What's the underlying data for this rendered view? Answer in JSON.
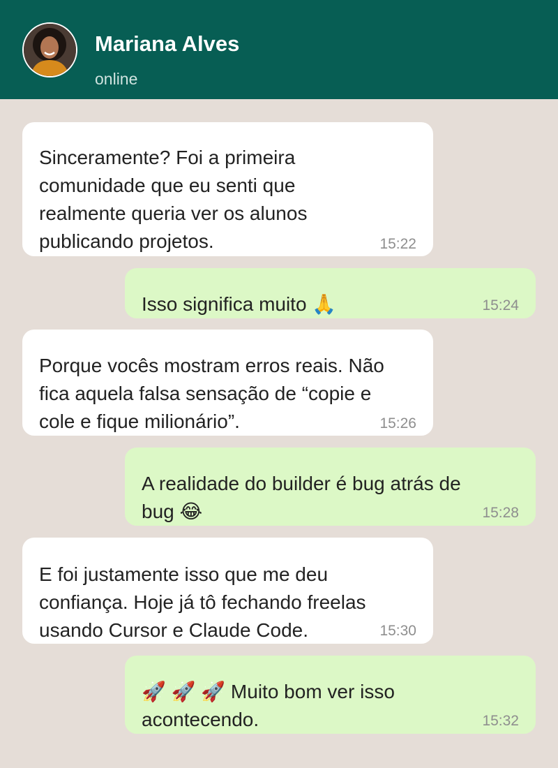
{
  "contact": {
    "name": "Mariana Alves",
    "status": "online"
  },
  "messages": [
    {
      "direction": "in",
      "text": "Sinceramente? Foi a primeira\ncomunidade que eu senti que\nrealmente queria ver os alunos\npublicando projetos.",
      "time": "15:22"
    },
    {
      "direction": "out",
      "text": "Isso significa muito 🙏",
      "time": "15:24"
    },
    {
      "direction": "in",
      "text": "Porque vocês mostram erros reais. Não\nfica aquela falsa sensação de “copie e\ncole e fique milionário”.",
      "time": "15:26"
    },
    {
      "direction": "out",
      "text": "A realidade do builder é bug atrás de\nbug 😂",
      "time": "15:28"
    },
    {
      "direction": "in",
      "text": "E foi justamente isso que me deu\nconfiança. Hoje já tô fechando freelas\nusando Cursor e Claude Code.",
      "time": "15:30"
    },
    {
      "direction": "out",
      "text": "🚀 🚀 🚀 Muito bom ver isso\nacontecendo.",
      "time": "15:32"
    }
  ]
}
